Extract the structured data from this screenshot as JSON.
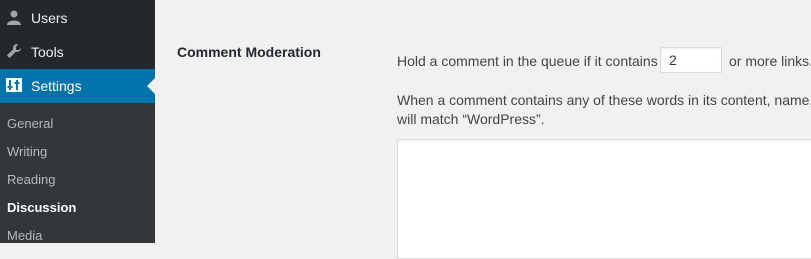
{
  "sidebar": {
    "menu": [
      {
        "label": "Users",
        "icon": "users-icon"
      },
      {
        "label": "Tools",
        "icon": "wrench-icon"
      },
      {
        "label": "Settings",
        "icon": "settings-icon"
      }
    ],
    "submenu": [
      {
        "label": "General"
      },
      {
        "label": "Writing"
      },
      {
        "label": "Reading"
      },
      {
        "label": "Discussion"
      },
      {
        "label": "Media"
      }
    ]
  },
  "main": {
    "section_label": "Comment Moderation",
    "queue_text_before": "Hold a comment in the queue if it contains",
    "queue_links_value": "2",
    "queue_text_after": "or more links.",
    "words_text_line1": "When a comment contains any of these words in its content, name,",
    "words_text_line2": "will match “WordPress”.",
    "moderation_keys_value": ""
  },
  "colors": {
    "sidebar_bg": "#23282d",
    "submenu_bg": "#32373c",
    "accent": "#0073aa"
  }
}
